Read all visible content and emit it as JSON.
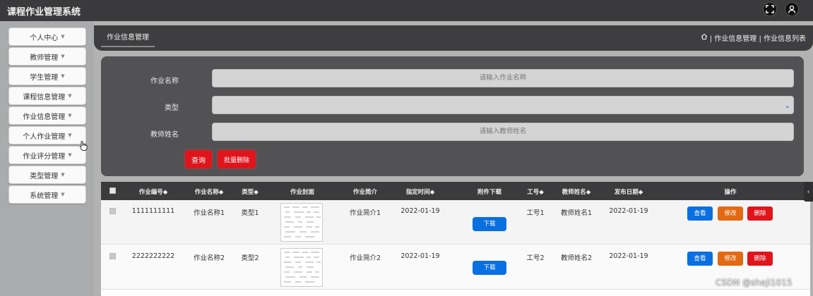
{
  "app": {
    "title": "课程作业管理系统"
  },
  "sidebar": {
    "items": [
      {
        "label": "个人中心"
      },
      {
        "label": "教师管理"
      },
      {
        "label": "学生管理"
      },
      {
        "label": "课程信息管理"
      },
      {
        "label": "作业信息管理"
      },
      {
        "label": "个人作业管理"
      },
      {
        "label": "作业评分管理"
      },
      {
        "label": "类型管理"
      },
      {
        "label": "系统管理"
      }
    ]
  },
  "header": {
    "section_title": "作业信息管理",
    "breadcrumb": "| 作业信息管理 | 作业信息列表"
  },
  "search": {
    "name_label": "作业名称",
    "name_placeholder": "请输入作业名称",
    "type_label": "类型",
    "teacher_label": "教师姓名",
    "teacher_placeholder": "请输入教师姓名",
    "query_button": "查询",
    "batch_delete_button": "批量删除"
  },
  "table": {
    "headers": [
      "作业编号◆",
      "作业名称◆",
      "类型◆",
      "作业封面",
      "作业简介",
      "指定时间◆",
      "附件下载",
      "工号◆",
      "教师姓名◆",
      "发布日期◆",
      "操作"
    ],
    "rows": [
      {
        "id": "1111111111",
        "name": "作业名称1",
        "type": "类型1",
        "intro": "作业简介1",
        "time": "2022-01-19",
        "download": "下载",
        "job_no": "工号1",
        "teacher": "教师姓名1",
        "date": "2022-01-19"
      },
      {
        "id": "2222222222",
        "name": "作业名称2",
        "type": "类型2",
        "intro": "作业简介2",
        "time": "2022-01-19",
        "download": "下载",
        "job_no": "工号2",
        "teacher": "教师姓名2",
        "date": "2022-01-19"
      }
    ],
    "actions": {
      "view": "查看",
      "edit": "修改",
      "delete": "删除"
    }
  },
  "watermark": "CSDN @sheji1015",
  "colors": {
    "primary": "#0a6fe0",
    "danger": "#e0151c",
    "warning": "#e26a13",
    "dark": "#3a3a3c"
  }
}
